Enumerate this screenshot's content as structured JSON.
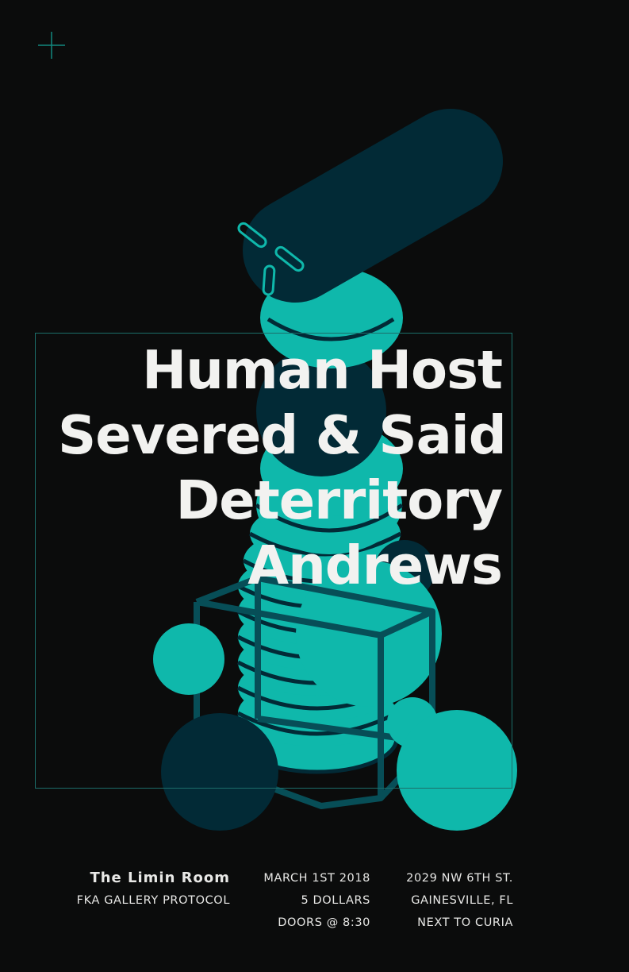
{
  "bands": [
    "Human Host",
    "Severed & Said",
    "Deterritory",
    "Andrews"
  ],
  "venue": {
    "name": "The Limin Room",
    "subtitle": "FKA GALLERY PROTOCOL"
  },
  "event": {
    "date": "MARCH 1ST 2018",
    "price": "5 DOLLARS",
    "doors": "DOORS @ 8:30"
  },
  "address": {
    "street": "2029 NW 6TH ST.",
    "city": "GAINESVILLE, FL",
    "note": "NEXT TO CURIA"
  },
  "colors": {
    "background": "#0b0c0c",
    "teal": "#0fb8ab",
    "navy": "#022a36",
    "text": "#f2f2f0"
  },
  "icons": [
    "plus-icon"
  ]
}
